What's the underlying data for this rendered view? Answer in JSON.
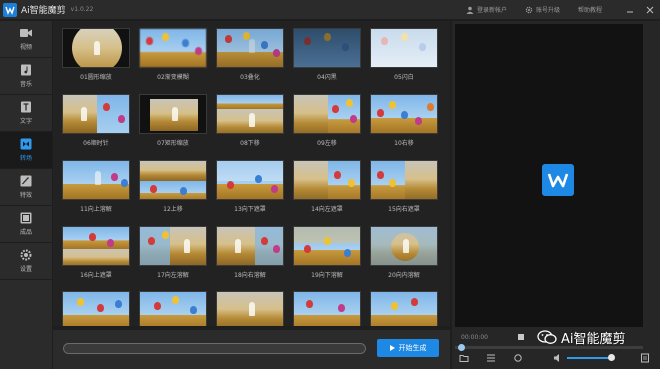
{
  "titlebar": {
    "app_title": "Ai智能魔剪",
    "version": "v1.0.22",
    "login": "登录新帐户",
    "upgrade": "账号升级",
    "help": "帮助教程"
  },
  "sidebar": {
    "items": [
      {
        "label": "视频",
        "icon": "video-icon",
        "active": false
      },
      {
        "label": "音乐",
        "icon": "music-icon",
        "active": false
      },
      {
        "label": "文字",
        "icon": "text-icon",
        "active": false
      },
      {
        "label": "转场",
        "icon": "transition-icon",
        "active": true
      },
      {
        "label": "特效",
        "icon": "effect-icon",
        "active": false
      },
      {
        "label": "成品",
        "icon": "product-icon",
        "active": false
      },
      {
        "label": "设置",
        "icon": "settings-icon",
        "active": false
      }
    ]
  },
  "transitions": [
    {
      "label": "01圆形缩放"
    },
    {
      "label": "02渐变模糊"
    },
    {
      "label": "03叠化"
    },
    {
      "label": "04闪黑"
    },
    {
      "label": "05闪白"
    },
    {
      "label": "06顺时针"
    },
    {
      "label": "07矩形缩放"
    },
    {
      "label": "08下移"
    },
    {
      "label": "09左移"
    },
    {
      "label": "10右移"
    },
    {
      "label": "11向上溶解"
    },
    {
      "label": "12上移"
    },
    {
      "label": "13向下遮罩"
    },
    {
      "label": "14向左遮罩"
    },
    {
      "label": "15向右遮罩"
    },
    {
      "label": "16向上遮罩"
    },
    {
      "label": "17向左溶解"
    },
    {
      "label": "18向右溶解"
    },
    {
      "label": "19向下溶解"
    },
    {
      "label": "20向内溶解"
    },
    {
      "label": ""
    },
    {
      "label": ""
    },
    {
      "label": ""
    },
    {
      "label": ""
    },
    {
      "label": ""
    }
  ],
  "bottom": {
    "generate_label": "开始生成"
  },
  "preview": {
    "timecode": "00:00:00"
  },
  "watermark": "Ai智能魔剪",
  "colors": {
    "accent": "#1e88e5",
    "active_text": "#2d9bf0"
  }
}
